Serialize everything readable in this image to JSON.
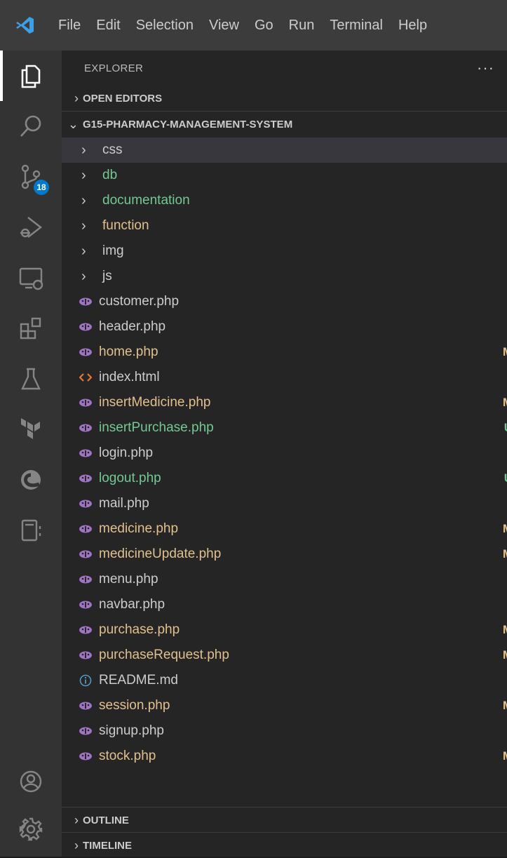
{
  "menu": [
    "File",
    "Edit",
    "Selection",
    "View",
    "Go",
    "Run",
    "Terminal",
    "Help"
  ],
  "activity": {
    "items": [
      {
        "name": "explorer-icon",
        "active": true
      },
      {
        "name": "search-icon"
      },
      {
        "name": "source-control-icon",
        "badge": "18"
      },
      {
        "name": "run-debug-icon"
      },
      {
        "name": "remote-explorer-icon"
      },
      {
        "name": "extensions-icon"
      },
      {
        "name": "testing-icon"
      },
      {
        "name": "terraform-icon"
      },
      {
        "name": "edge-icon"
      },
      {
        "name": "notebook-icon"
      }
    ],
    "bottom": [
      {
        "name": "account-icon"
      },
      {
        "name": "settings-gear-icon"
      }
    ]
  },
  "sidebar": {
    "title": "EXPLORER",
    "more": "···",
    "open_editors": "OPEN EDITORS",
    "project": "G15-PHARMACY-MANAGEMENT-SYSTEM",
    "outline": "OUTLINE",
    "timeline": "TIMELINE",
    "folders": [
      {
        "label": "css",
        "color": "#cccccc",
        "dot": "#8c8c8c",
        "selected": true
      },
      {
        "label": "db",
        "color": "#73c991",
        "dot": "#73c991"
      },
      {
        "label": "documentation",
        "color": "#73c991",
        "dot": "#73c991"
      },
      {
        "label": "function",
        "color": "#e2c08d",
        "dot": "#e2c08d"
      },
      {
        "label": "img",
        "color": "#cccccc"
      },
      {
        "label": "js",
        "color": "#cccccc"
      }
    ],
    "files": [
      {
        "label": "customer.php",
        "icon": "php",
        "color": "#cccccc",
        "status": ""
      },
      {
        "label": "header.php",
        "icon": "php",
        "color": "#cccccc",
        "status": ""
      },
      {
        "label": "home.php",
        "icon": "php",
        "color": "#e2c08d",
        "status": "M"
      },
      {
        "label": "index.html",
        "icon": "html",
        "color": "#cccccc",
        "status": ""
      },
      {
        "label": "insertMedicine.php",
        "icon": "php",
        "color": "#e2c08d",
        "status": "M"
      },
      {
        "label": "insertPurchase.php",
        "icon": "php",
        "color": "#73c991",
        "status": "U"
      },
      {
        "label": "login.php",
        "icon": "php",
        "color": "#cccccc",
        "status": ""
      },
      {
        "label": "logout.php",
        "icon": "php",
        "color": "#73c991",
        "status": "U"
      },
      {
        "label": "mail.php",
        "icon": "php",
        "color": "#cccccc",
        "status": ""
      },
      {
        "label": "medicine.php",
        "icon": "php",
        "color": "#e2c08d",
        "status": "M"
      },
      {
        "label": "medicineUpdate.php",
        "icon": "php",
        "color": "#e2c08d",
        "status": "M"
      },
      {
        "label": "menu.php",
        "icon": "php",
        "color": "#cccccc",
        "status": ""
      },
      {
        "label": "navbar.php",
        "icon": "php",
        "color": "#cccccc",
        "status": ""
      },
      {
        "label": "purchase.php",
        "icon": "php",
        "color": "#e2c08d",
        "status": "M"
      },
      {
        "label": "purchaseRequest.php",
        "icon": "php",
        "color": "#e2c08d",
        "status": "M"
      },
      {
        "label": "README.md",
        "icon": "info",
        "color": "#cccccc",
        "status": ""
      },
      {
        "label": "session.php",
        "icon": "php",
        "color": "#e2c08d",
        "status": "M"
      },
      {
        "label": "signup.php",
        "icon": "php",
        "color": "#cccccc",
        "status": ""
      },
      {
        "label": "stock.php",
        "icon": "php",
        "color": "#e2c08d",
        "status": "M"
      }
    ]
  },
  "colors": {
    "modified": "#e2c08d",
    "untracked": "#73c991",
    "accent": "#007acc"
  }
}
